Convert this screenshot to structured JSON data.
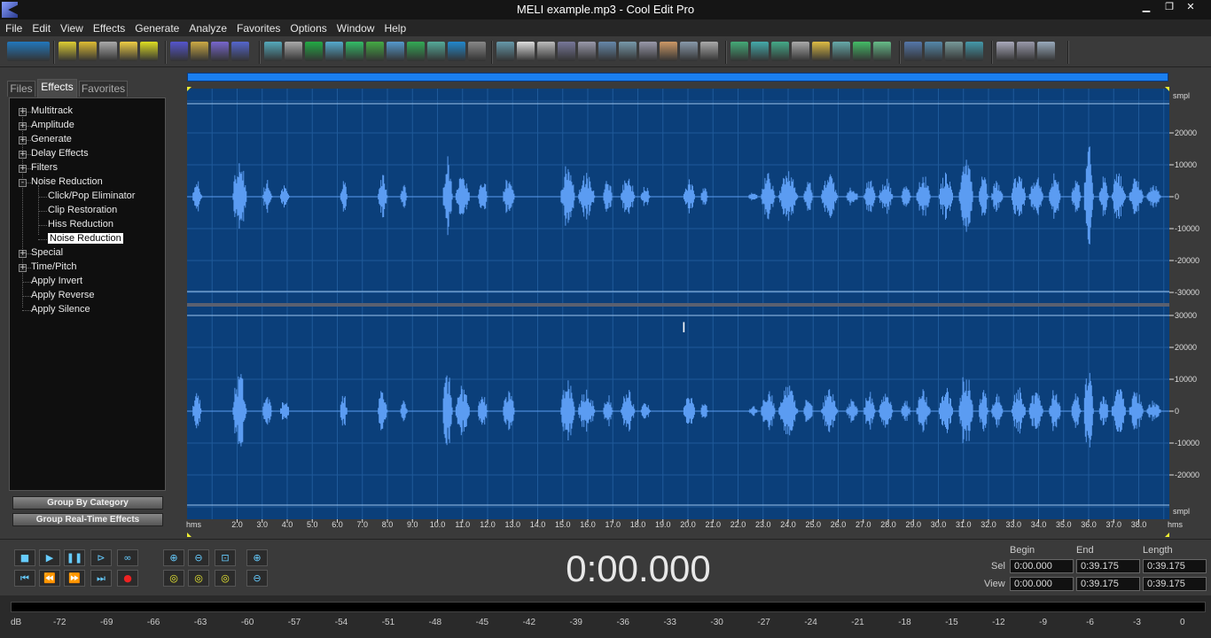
{
  "window": {
    "title": "MELI example.mp3 - Cool Edit Pro"
  },
  "menu": [
    "File",
    "Edit",
    "View",
    "Effects",
    "Generate",
    "Analyze",
    "Favorites",
    "Options",
    "Window",
    "Help"
  ],
  "panel": {
    "tabs": [
      "Files",
      "Effects",
      "Favorites"
    ],
    "active_tab": "Effects",
    "tree": [
      {
        "label": "Multitrack",
        "level": 0,
        "expander": "+"
      },
      {
        "label": "Amplitude",
        "level": 0,
        "expander": "+"
      },
      {
        "label": "Generate",
        "level": 0,
        "expander": "+"
      },
      {
        "label": "Delay Effects",
        "level": 0,
        "expander": "+"
      },
      {
        "label": "Filters",
        "level": 0,
        "expander": "+"
      },
      {
        "label": "Noise Reduction",
        "level": 0,
        "expander": "-"
      },
      {
        "label": "Click/Pop Eliminator",
        "level": 1,
        "expander": ""
      },
      {
        "label": "Clip Restoration",
        "level": 1,
        "expander": ""
      },
      {
        "label": "Hiss Reduction",
        "level": 1,
        "expander": ""
      },
      {
        "label": "Noise Reduction",
        "level": 1,
        "expander": "",
        "selected": true
      },
      {
        "label": "Special",
        "level": 0,
        "expander": "+"
      },
      {
        "label": "Time/Pitch",
        "level": 0,
        "expander": "+"
      },
      {
        "label": "Apply Invert",
        "level": 0,
        "expander": ""
      },
      {
        "label": "Apply Reverse",
        "level": 0,
        "expander": ""
      },
      {
        "label": "Apply Silence",
        "level": 0,
        "expander": ""
      }
    ],
    "buttons": [
      "Group By Category",
      "Group Real-Time Effects"
    ]
  },
  "wave": {
    "unit_label": "smpl",
    "channel1_ticks": [
      "20000",
      "10000",
      "0",
      "-10000",
      "-20000",
      "-30000"
    ],
    "channel2_ticks": [
      "30000",
      "20000",
      "10000",
      "0",
      "-10000",
      "-20000"
    ],
    "time_unit": "hms",
    "time_ticks": [
      "2.0",
      "3.0",
      "4.0",
      "5.0",
      "6.0",
      "7.0",
      "8.0",
      "9.0",
      "10.0",
      "11.0",
      "12.0",
      "13.0",
      "14.0",
      "15.0",
      "16.0",
      "17.0",
      "18.0",
      "19.0",
      "20.0",
      "21.0",
      "22.0",
      "23.0",
      "24.0",
      "25.0",
      "26.0",
      "27.0",
      "28.0",
      "29.0",
      "30.0",
      "31.0",
      "32.0",
      "33.0",
      "34.0",
      "35.0",
      "36.0",
      "37.0",
      "38.0"
    ],
    "colors": {
      "bg": "#0b3f7a",
      "wave": "#5b9cf2",
      "grid": "#1f5a9a"
    }
  },
  "transport": {
    "time": "0:00.000"
  },
  "selection": {
    "headers": [
      "Begin",
      "End",
      "Length"
    ],
    "rows": [
      {
        "label": "Sel",
        "begin": "0:00.000",
        "end": "0:39.175",
        "length": "0:39.175"
      },
      {
        "label": "View",
        "begin": "0:00.000",
        "end": "0:39.175",
        "length": "0:39.175"
      }
    ]
  },
  "meter": {
    "unit": "dB",
    "ticks": [
      "-72",
      "-69",
      "-66",
      "-63",
      "-60",
      "-57",
      "-54",
      "-51",
      "-48",
      "-45",
      "-42",
      "-39",
      "-36",
      "-33",
      "-30",
      "-27",
      "-24",
      "-21",
      "-18",
      "-15",
      "-12",
      "-9",
      "-6",
      "-3",
      "0"
    ]
  }
}
